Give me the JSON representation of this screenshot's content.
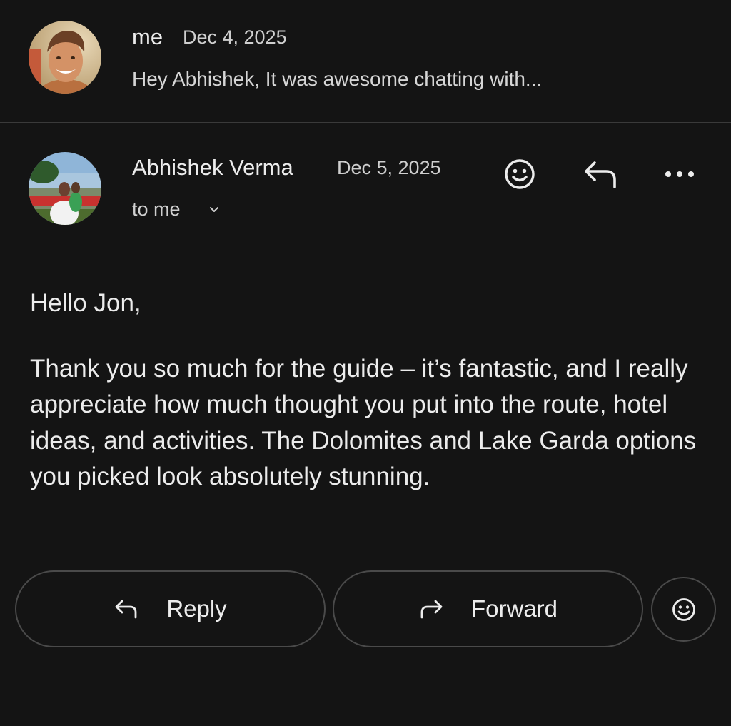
{
  "collapsed_message": {
    "sender": "me",
    "date": "Dec 4, 2025",
    "snippet": "Hey Abhishek, It was awesome chatting with...",
    "avatar_icon": "user-photo-avatar"
  },
  "expanded_message": {
    "sender": "Abhishek Verma",
    "date": "Dec 5, 2025",
    "recipient_line": "to me",
    "avatar_icon": "contact-photo-avatar",
    "header_actions": [
      "emoji-reaction-icon",
      "reply-icon",
      "more-options-icon"
    ],
    "greeting": "Hello Jon,",
    "body": "Thank you so much for the guide – it’s fantastic, and I really appreciate how much thought you put into the route, hotel ideas, and activities. The Dolomites and Lake Garda options you picked look absolutely stunning."
  },
  "actions": {
    "reply_label": "Reply",
    "forward_label": "Forward",
    "emoji_icon": "add-reaction-icon"
  },
  "colors": {
    "background": "#141414",
    "text": "#ececec",
    "secondary_text": "#cfcfcf",
    "border": "#4a4a4a",
    "divider": "#3a3a3a"
  }
}
